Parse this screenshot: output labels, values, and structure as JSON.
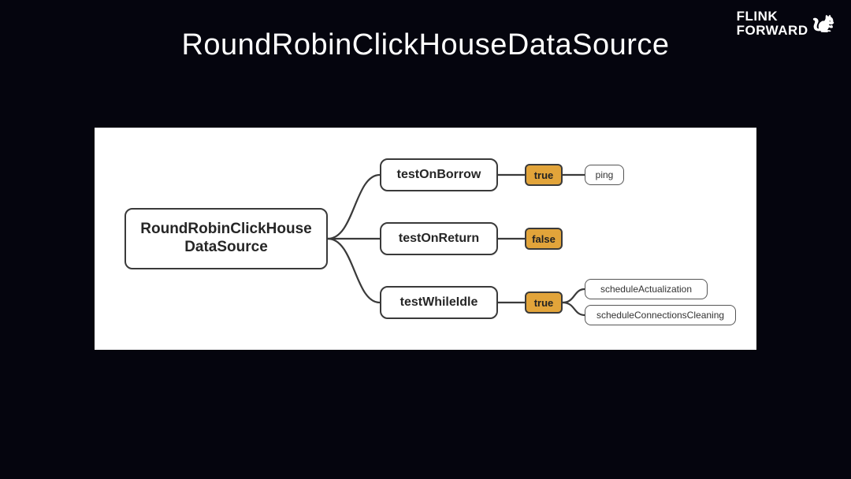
{
  "title": "RoundRobinClickHouseDataSource",
  "logo": {
    "line1": "FLINK",
    "line2": "FORWARD"
  },
  "diagram": {
    "root": "RoundRobinClickHouse\nDataSource",
    "branches": [
      {
        "label": "testOnBorrow",
        "value": "true",
        "children": [
          "ping"
        ]
      },
      {
        "label": "testOnReturn",
        "value": "false",
        "children": []
      },
      {
        "label": "testWhileIdle",
        "value": "true",
        "children": [
          "scheduleActualization",
          "scheduleConnectionsCleaning"
        ]
      }
    ]
  }
}
